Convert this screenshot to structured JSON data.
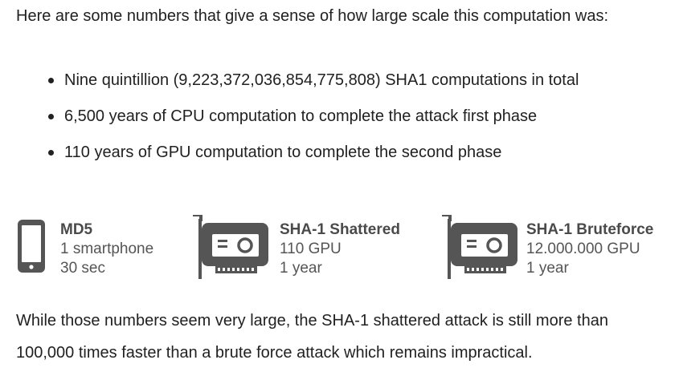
{
  "intro": "Here are some numbers that give a sense of how large scale this computation was:",
  "bullets": [
    "Nine quintillion (9,223,372,036,854,775,808) SHA1 computations in total",
    "6,500 years of CPU computation to complete the attack first phase",
    "110 years of GPU computation to complete the second phase"
  ],
  "infographic": {
    "icon_color": "#555555",
    "cards": [
      {
        "icon": "smartphone-icon",
        "name": "MD5",
        "resource": "1 smartphone",
        "time": "30 sec"
      },
      {
        "icon": "gpu-card-icon",
        "name": "SHA-1 Shattered",
        "resource": "110 GPU",
        "time": "1 year"
      },
      {
        "icon": "gpu-card-icon",
        "name": "SHA-1 Bruteforce",
        "resource": "12.000.000 GPU",
        "time": "1 year"
      }
    ]
  },
  "outro": "While those numbers seem very large, the SHA-1 shattered attack is still more than 100,000 times faster than a brute force attack which remains impractical."
}
